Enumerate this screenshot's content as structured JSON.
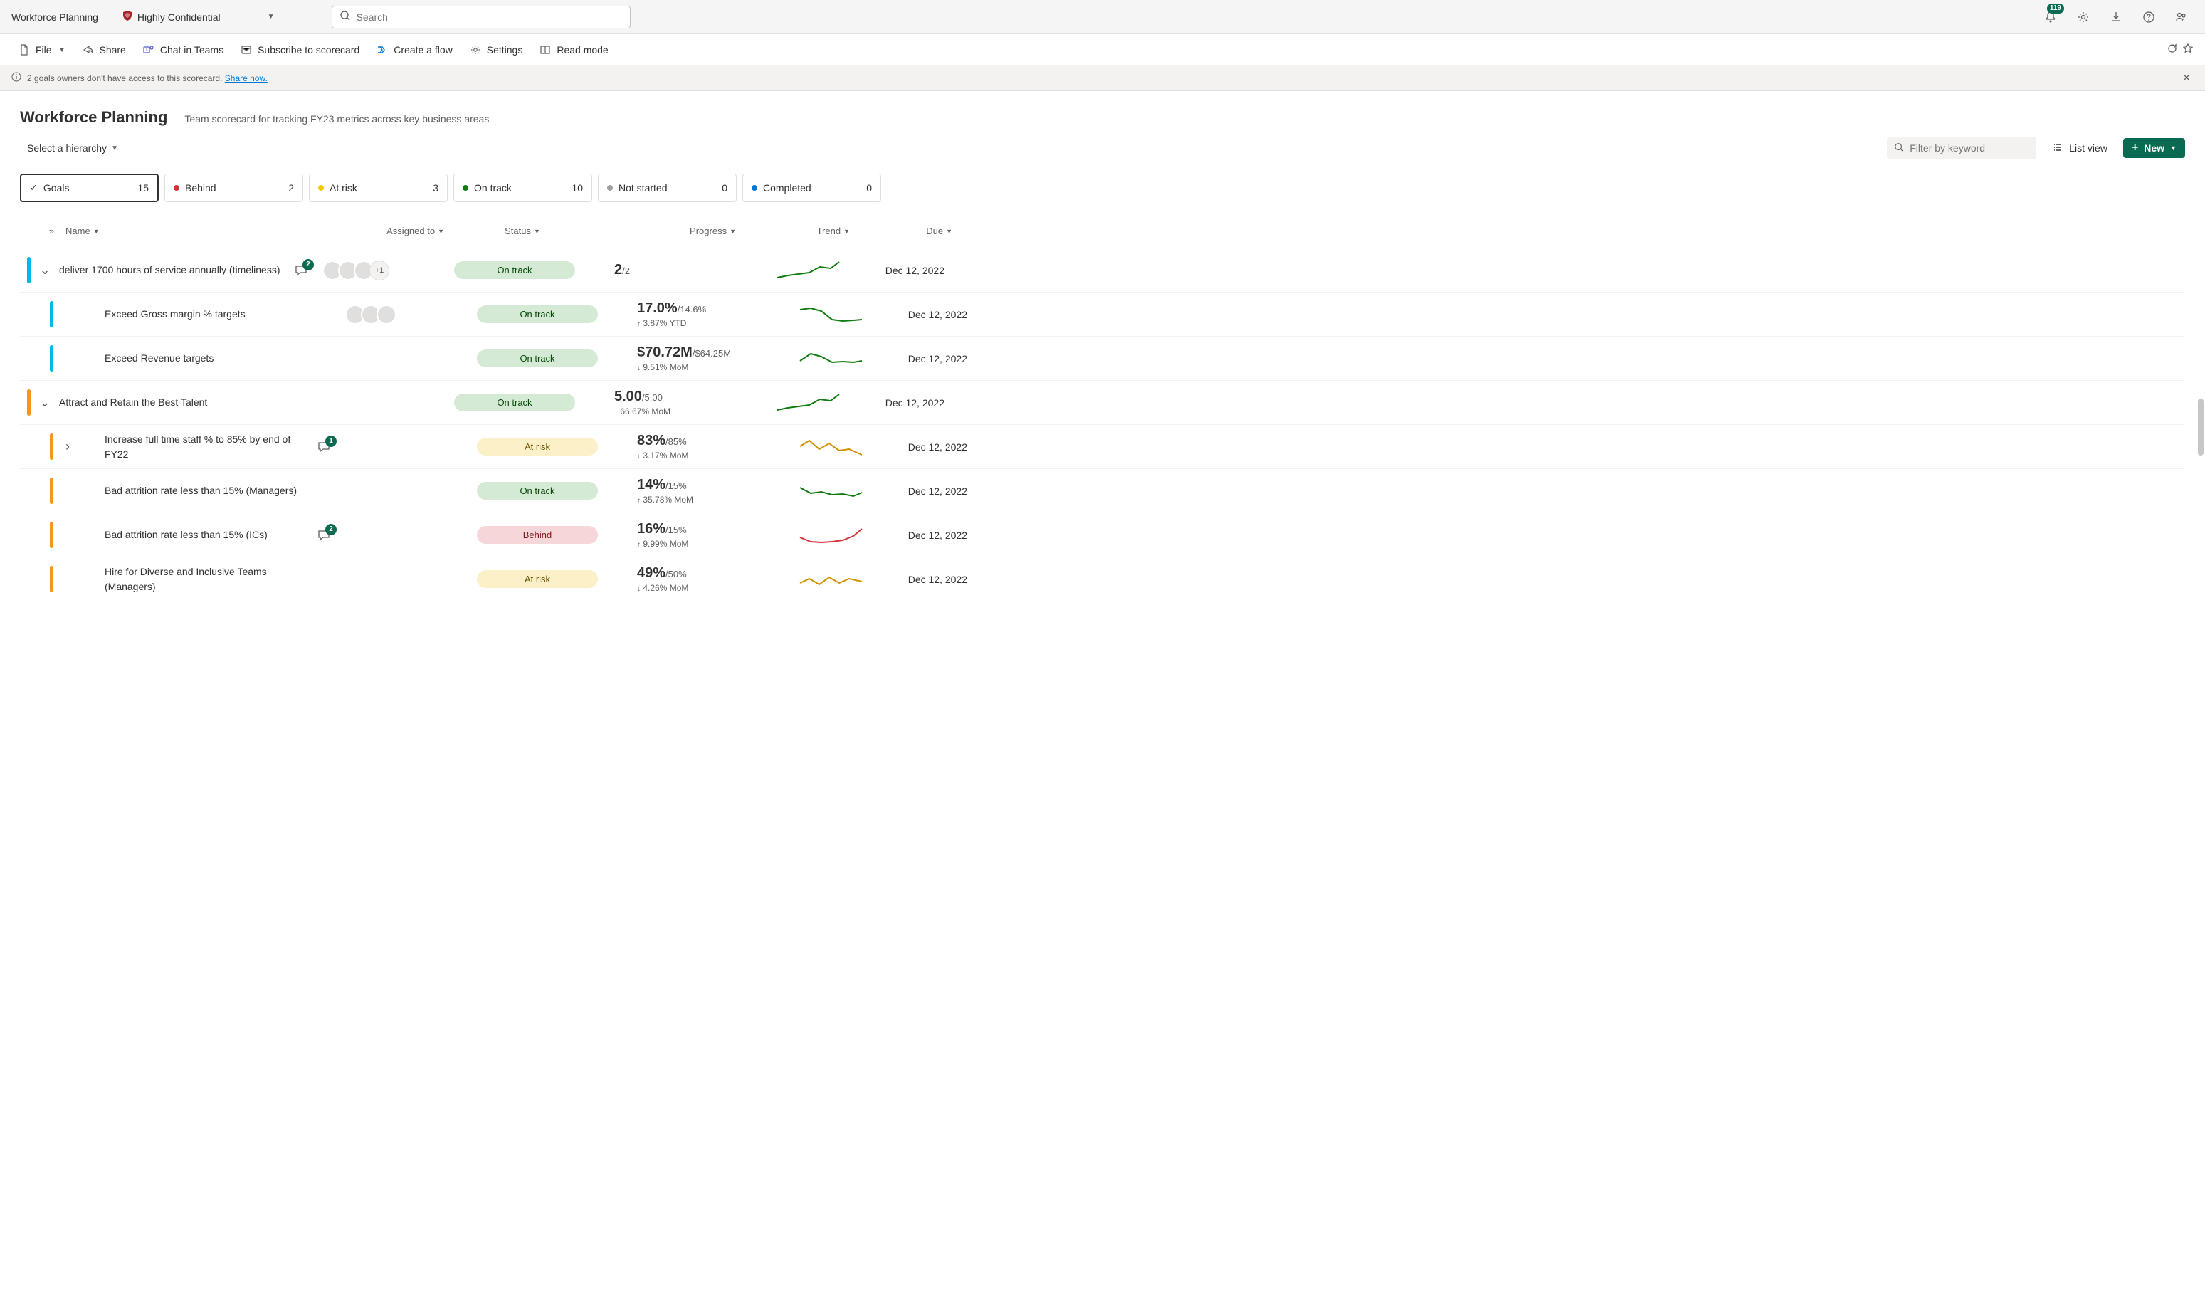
{
  "topbar": {
    "title": "Workforce Planning",
    "sensitivity": "Highly Confidential",
    "search_placeholder": "Search",
    "notification_count": "119"
  },
  "commands": {
    "file": "File",
    "share": "Share",
    "chat": "Chat in Teams",
    "subscribe": "Subscribe to scorecard",
    "flow": "Create a flow",
    "settings": "Settings",
    "read": "Read mode"
  },
  "banner": {
    "text": "2 goals owners don't have access to this scorecard. ",
    "link": "Share now."
  },
  "header": {
    "title": "Workforce Planning",
    "desc": "Team scorecard for tracking FY23 metrics across key business areas",
    "hierarchy": "Select a hierarchy",
    "filter_placeholder": "Filter by keyword",
    "list_view": "List view",
    "new": "New"
  },
  "tiles": [
    {
      "label": "Goals",
      "count": "15",
      "kind": "check",
      "active": true
    },
    {
      "label": "Behind",
      "count": "2",
      "kind": "red"
    },
    {
      "label": "At risk",
      "count": "3",
      "kind": "yellow"
    },
    {
      "label": "On track",
      "count": "10",
      "kind": "green"
    },
    {
      "label": "Not started",
      "count": "0",
      "kind": "gray"
    },
    {
      "label": "Completed",
      "count": "0",
      "kind": "blue"
    }
  ],
  "columns": {
    "name": "Name",
    "assigned": "Assigned to",
    "status": "Status",
    "progress": "Progress",
    "trend": "Trend",
    "due": "Due"
  },
  "statuses": {
    "ontrack": "On track",
    "atrisk": "At risk",
    "behind": "Behind"
  },
  "rows": [
    {
      "name": "deliver 1700 hours of service annually (timeliness)",
      "stripe": "blue",
      "level": 0,
      "expander": true,
      "comments": "2",
      "avatars": 4,
      "status": "ontrack",
      "p_main": "2",
      "p_sub": "/2",
      "due": "Dec 12, 2022",
      "trend": "up-green"
    },
    {
      "name": "Exceed Gross margin % targets",
      "stripe": "blue",
      "level": 1,
      "avatars": 3,
      "status": "ontrack",
      "p_main": "17.0%",
      "p_sub": "/14.6%",
      "delta_dir": "up",
      "delta": "3.87% YTD",
      "due": "Dec 12, 2022",
      "trend": "down-green"
    },
    {
      "name": "Exceed Revenue targets",
      "stripe": "blue",
      "level": 1,
      "status": "ontrack",
      "p_main": "$70.72M",
      "p_sub": "/$64.25M",
      "delta_dir": "down",
      "delta": "9.51% MoM",
      "due": "Dec 12, 2022",
      "trend": "flat-green"
    },
    {
      "name": "Attract and Retain the Best Talent",
      "stripe": "orange",
      "level": 0,
      "expander": true,
      "status": "ontrack",
      "p_main": "5.00",
      "p_sub": "/5.00",
      "delta_dir": "up",
      "delta": "66.67% MoM",
      "due": "Dec 12, 2022",
      "trend": "up-green"
    },
    {
      "name": "Increase full time staff % to 85% by end of FY22",
      "stripe": "orange",
      "level": 1,
      "expander": true,
      "expand_icon": "right",
      "comments": "1",
      "status": "atrisk",
      "p_main": "83%",
      "p_sub": "/85%",
      "delta_dir": "down",
      "delta": "3.17% MoM",
      "due": "Dec 12, 2022",
      "trend": "down-yellow"
    },
    {
      "name": "Bad attrition rate less than 15% (Managers)",
      "stripe": "orange",
      "level": 1,
      "status": "ontrack",
      "p_main": "14%",
      "p_sub": "/15%",
      "delta_dir": "up",
      "delta": "35.78% MoM",
      "due": "Dec 12, 2022",
      "trend": "flat-green2"
    },
    {
      "name": "Bad attrition rate less than 15% (ICs)",
      "stripe": "orange",
      "level": 1,
      "comments": "2",
      "status": "behind",
      "p_main": "16%",
      "p_sub": "/15%",
      "delta_dir": "up",
      "delta": "9.99% MoM",
      "due": "Dec 12, 2022",
      "trend": "up-red"
    },
    {
      "name": "Hire for Diverse and Inclusive Teams (Managers)",
      "stripe": "orange",
      "level": 1,
      "status": "atrisk",
      "p_main": "49%",
      "p_sub": "/50%",
      "delta_dir": "down",
      "delta": "4.26% MoM",
      "due": "Dec 12, 2022",
      "trend": "zig-yellow"
    }
  ]
}
